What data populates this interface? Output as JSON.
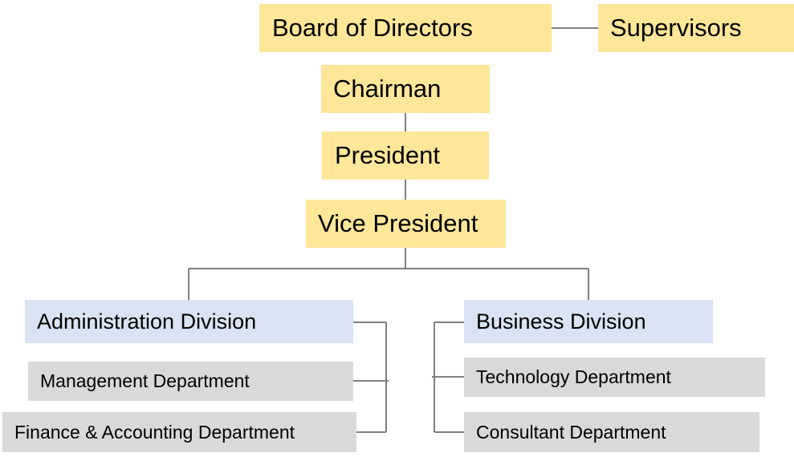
{
  "colors": {
    "executive": "#FFE699",
    "division": "#DAE3F3",
    "department": "#D9D9D9",
    "connector": "#7F7F7F"
  },
  "nodes": {
    "board": "Board of Directors",
    "supervisors": "Supervisors",
    "chairman": "Chairman",
    "president": "President",
    "vice_president": "Vice President",
    "admin_division": "Administration Division",
    "management_dept": "Management Department",
    "finance_dept": "Finance & Accounting Department",
    "business_division": "Business Division",
    "technology_dept": "Technology Department",
    "consultant_dept": "Consultant Department"
  }
}
